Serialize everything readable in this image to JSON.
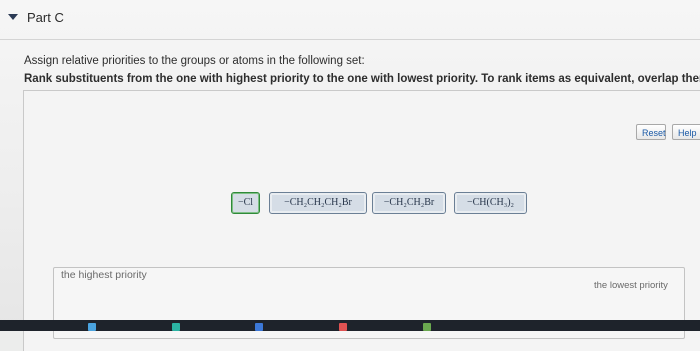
{
  "part": {
    "title": "Part C"
  },
  "instructions": {
    "line1": "Assign relative priorities to the groups or atoms in the following set:",
    "line2": "Rank substituents from the one with highest priority to the one with lowest priority. To rank items as equivalent, overlap them."
  },
  "toolbar": {
    "reset_label": "Reset",
    "help_label": "Help"
  },
  "tiles": [
    {
      "label": "−Cl",
      "selected": true
    },
    {
      "label": "−CH₂CH₂CH₂Br",
      "selected": false
    },
    {
      "label": "−CH₂CH₂Br",
      "selected": false
    },
    {
      "label": "−CH(CH₃)₂",
      "selected": false
    }
  ],
  "ranking": {
    "highest_label": "the highest priority",
    "lowest_label": "the lowest priority"
  },
  "colors": {
    "tile_border": "#6b7f95",
    "tile_fill": "#d5dde6",
    "selected_border": "#2f8a3a",
    "link_blue": "#1b5aa6",
    "taskbar": "#1e232b"
  },
  "taskbar": {
    "icons": [
      "window-icon",
      "app-icon-teal",
      "app-icon-blue",
      "app-icon-red",
      "app-icon-green"
    ]
  }
}
